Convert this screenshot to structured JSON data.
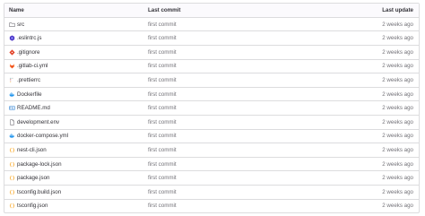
{
  "header": {
    "name": "Name",
    "commit": "Last commit",
    "update": "Last update"
  },
  "files": [
    {
      "name": "src",
      "commit": "first commit",
      "date": "2 weeks ago",
      "icon": "folder-icon"
    },
    {
      "name": ".eslintrc.js",
      "commit": "first commit",
      "date": "2 weeks ago",
      "icon": "eslint-icon"
    },
    {
      "name": ".gitignore",
      "commit": "first commit",
      "date": "2 weeks ago",
      "icon": "git-icon"
    },
    {
      "name": ".gitlab-ci.yml",
      "commit": "first commit",
      "date": "2 weeks ago",
      "icon": "gitlab-icon"
    },
    {
      "name": ".prettierrc",
      "commit": "first commit",
      "date": "2 weeks ago",
      "icon": "prettier-icon"
    },
    {
      "name": "Dockerfile",
      "commit": "first commit",
      "date": "2 weeks ago",
      "icon": "docker-icon"
    },
    {
      "name": "README.md",
      "commit": "first commit",
      "date": "2 weeks ago",
      "icon": "markdown-icon"
    },
    {
      "name": "development.env",
      "commit": "first commit",
      "date": "2 weeks ago",
      "icon": "document-icon"
    },
    {
      "name": "docker-compose.yml",
      "commit": "first commit",
      "date": "2 weeks ago",
      "icon": "docker-icon"
    },
    {
      "name": "nest-cli.json",
      "commit": "first commit",
      "date": "2 weeks ago",
      "icon": "json-icon"
    },
    {
      "name": "package-lock.json",
      "commit": "first commit",
      "date": "2 weeks ago",
      "icon": "json-icon"
    },
    {
      "name": "package.json",
      "commit": "first commit",
      "date": "2 weeks ago",
      "icon": "json-icon"
    },
    {
      "name": "tsconfig.build.json",
      "commit": "first commit",
      "date": "2 weeks ago",
      "icon": "json-icon"
    },
    {
      "name": "tsconfig.json",
      "commit": "first commit",
      "date": "2 weeks ago",
      "icon": "json-icon"
    }
  ]
}
